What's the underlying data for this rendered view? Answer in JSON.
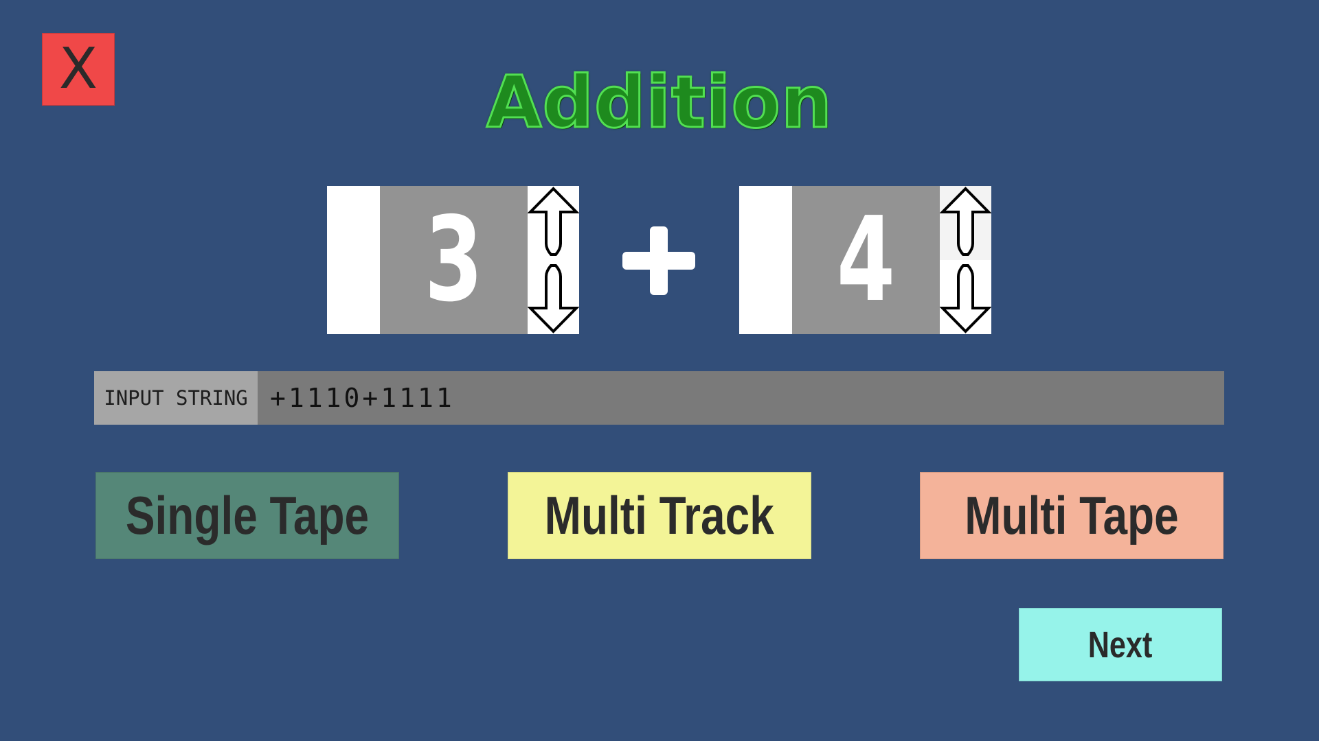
{
  "close_button": {
    "label": "X"
  },
  "title": "Addition",
  "operands": [
    {
      "value": "3"
    },
    {
      "value": "4"
    }
  ],
  "operator": "+",
  "input": {
    "label": "INPUT STRING",
    "value": "+1110+1111"
  },
  "modes": {
    "single_tape": "Single Tape",
    "multi_track": "Multi Track",
    "multi_tape": "Multi Tape"
  },
  "next_button": {
    "label": "Next"
  },
  "colors": {
    "background": "#324e79",
    "close": "#f04848",
    "title": "#1e8a1e",
    "single_tape": "#558778",
    "multi_track": "#f3f497",
    "multi_tape": "#f4b39a",
    "next": "#96f3ea"
  }
}
